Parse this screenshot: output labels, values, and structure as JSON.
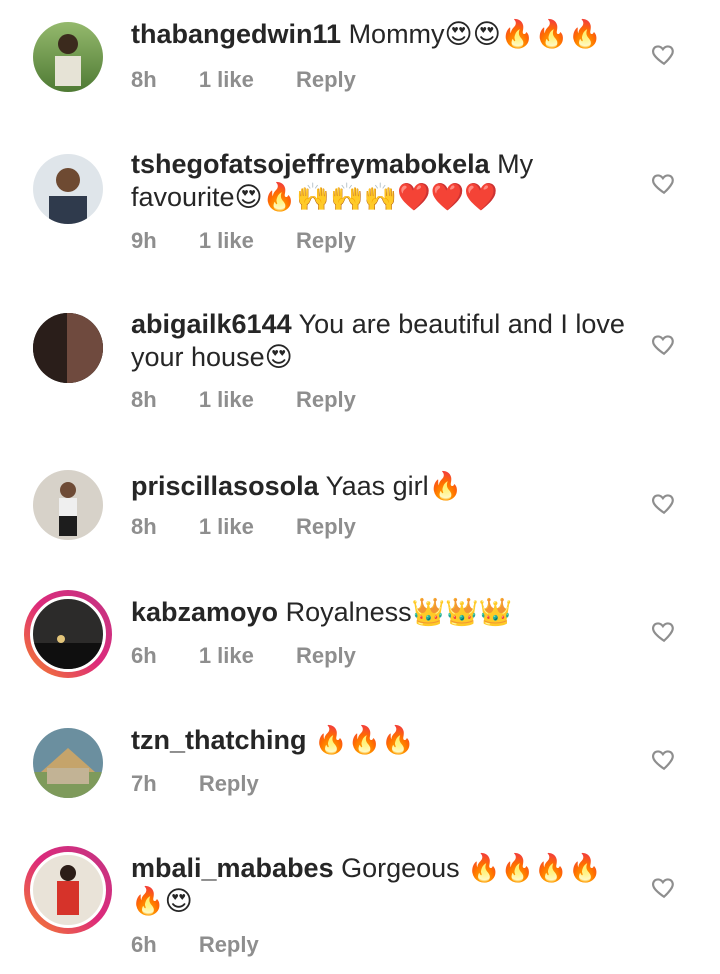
{
  "comments": [
    {
      "user": "thabangedwin11",
      "text": "Mommy😍😍🔥🔥🔥",
      "time": "8h",
      "likes": "1 like",
      "reply": "Reply"
    },
    {
      "user": "tshegofatsojeffreymabokela",
      "text": "My favourite😍🔥🙌🙌🙌❤️❤️❤️",
      "time": "9h",
      "likes": "1 like",
      "reply": "Reply"
    },
    {
      "user": "abigailk6144",
      "text": "You are beautiful and I love your house😍",
      "time": "8h",
      "likes": "1 like",
      "reply": "Reply"
    },
    {
      "user": "priscillasosola",
      "text": "Yaas girl🔥",
      "time": "8h",
      "likes": "1 like",
      "reply": "Reply"
    },
    {
      "user": "kabzamoyo",
      "text": "Royalness👑👑👑",
      "time": "6h",
      "likes": "1 like",
      "reply": "Reply"
    },
    {
      "user": "tzn_thatching",
      "text": "🔥🔥🔥",
      "time": "7h",
      "likes": "",
      "reply": "Reply"
    },
    {
      "user": "mbali_mababes",
      "text": "Gorgeous 🔥🔥🔥🔥🔥😍",
      "time": "6h",
      "likes": "",
      "reply": "Reply"
    }
  ],
  "icons": {
    "like": "heart-outline-icon"
  }
}
